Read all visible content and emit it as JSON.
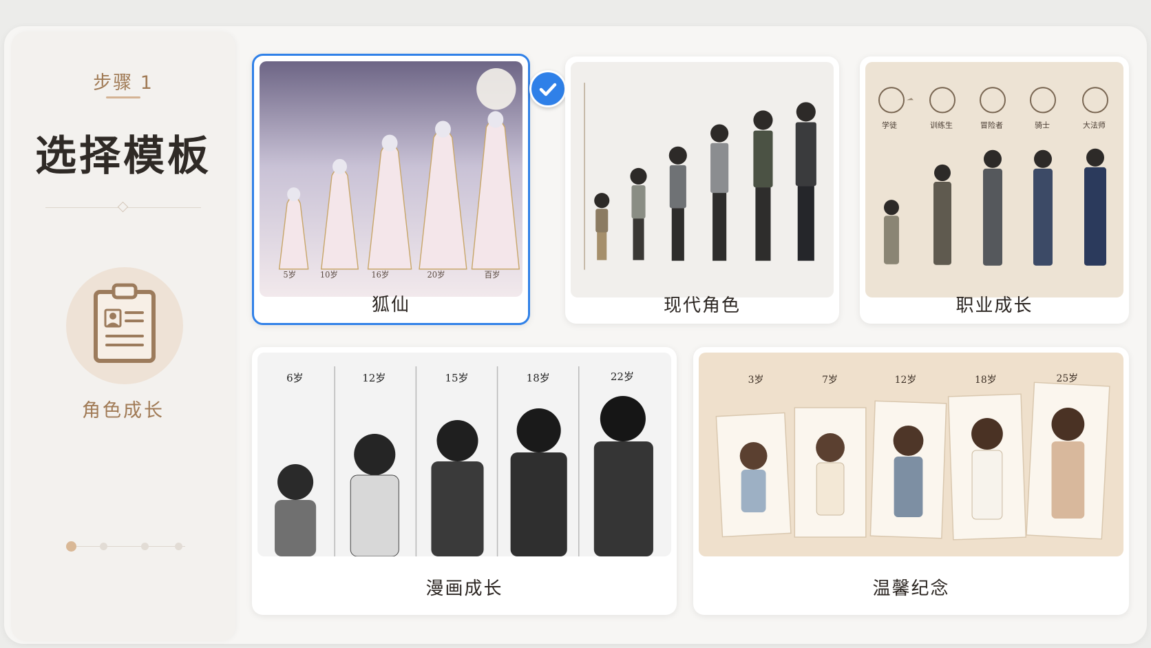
{
  "sidebar": {
    "step_label": "步骤 1",
    "title": "选择模板",
    "category_icon": "clipboard-profile-icon",
    "category_label": "角色成长",
    "progress_total": 4,
    "progress_current": 1
  },
  "templates": [
    {
      "label": "狐仙",
      "selected": true,
      "ages": [
        "5岁",
        "10岁",
        "16岁",
        "20岁",
        "百岁"
      ]
    },
    {
      "label": "现代角色",
      "selected": false
    },
    {
      "label": "职业成长",
      "selected": false,
      "stages": [
        "学徒",
        "训练生",
        "冒险者",
        "骑士",
        "大法师"
      ]
    },
    {
      "label": "漫画成长",
      "selected": false,
      "ages": [
        "6岁",
        "12岁",
        "15岁",
        "18岁",
        "22岁"
      ]
    },
    {
      "label": "温馨纪念",
      "selected": false,
      "ages": [
        "3岁",
        "7岁",
        "12岁",
        "18岁",
        "25岁"
      ]
    }
  ],
  "colors": {
    "accent": "#2f80e8",
    "brand": "#a07a55",
    "background": "#f7f6f4"
  },
  "icons": {
    "selected_badge": "checkmark-icon"
  }
}
